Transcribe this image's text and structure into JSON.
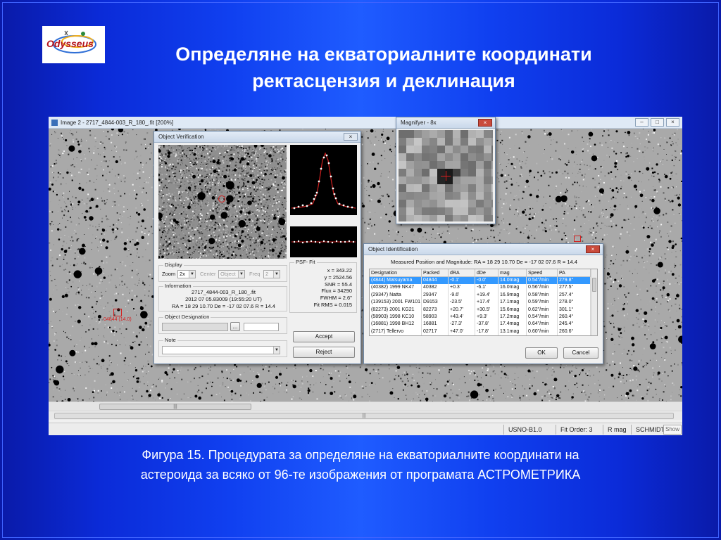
{
  "logo": {
    "text": "Odysseus"
  },
  "title": {
    "line1": "Определяне на екваториалните координати",
    "line2": "ректасцензия и деклинация"
  },
  "screenshot": {
    "image_title": "Image 2 - 2717_4844-003_R_180_.fit [200%]",
    "object_label": "04844 (14.0)",
    "verification": {
      "title": "Object Verification",
      "display": {
        "label": "Display",
        "zoom_label": "Zoom",
        "zoom_value": "2x",
        "center_label": "Center",
        "center_value": "Object",
        "freq_label": "Freq",
        "freq_value": "2"
      },
      "psf": {
        "label": "PSF- Fit",
        "x": "x = 343.22",
        "y": "y = 2524.56",
        "snr": "SNR = 55.4",
        "flux": "Flux = 34290",
        "fwhm": "FWHM = 2.6''",
        "fitrms": "Fit RMS = 0.015"
      },
      "information": {
        "label": "Information",
        "file": "2717_4844-003_R_180_.fit",
        "date": "2012 07 05.83009 (19:55:20 UT)",
        "coords": "RA = 18 29 10.70   De = -17 02 07.6   R = 14.4"
      },
      "designation": {
        "label": "Object Designation",
        "btn": "..."
      },
      "note": {
        "label": "Note"
      },
      "accept": "Accept",
      "reject": "Reject"
    },
    "magnifier": {
      "title": "Magnifyer - 8x"
    },
    "identification": {
      "title": "Object Identification",
      "measured": "Measured Position and Magnitude:  RA = 18 29 10.70   De = -17 02 07.6   R = 14.4",
      "columns": [
        "Designation",
        "Packed",
        "dRA",
        "dDe",
        "mag",
        "Speed",
        "PA"
      ],
      "rows": [
        [
          "(4844) Matsuyama",
          "04844",
          "-0.1'",
          "-0.0'",
          "14.0mag",
          "0.54\"/min",
          "279.8°"
        ],
        [
          "(40382) 1999 NK47",
          "40382",
          "+0.3'",
          "-6.1'",
          "16.0mag",
          "0.56\"/min",
          "277.5°"
        ],
        [
          "(29347) Natta",
          "29347",
          "-9.6'",
          "+19.4'",
          "16.9mag",
          "0.58\"/min",
          "257.4°"
        ],
        [
          "(139153) 2001 FW101",
          "D9153",
          "-23.5'",
          "+17.4'",
          "17.1mag",
          "0.59\"/min",
          "278.0°"
        ],
        [
          "(82273) 2001 KG21",
          "82273",
          "+20.7'",
          "+30.5'",
          "15.6mag",
          "0.62\"/min",
          "301.1°"
        ],
        [
          "(58903) 1998 KC10",
          "58903",
          "+43.4'",
          "+9.3'",
          "17.2mag",
          "0.54\"/min",
          "260.4°"
        ],
        [
          "(16881) 1998 BH12",
          "16881",
          "-27.3'",
          "-37.8'",
          "17.4mag",
          "0.64\"/min",
          "245.4°"
        ],
        [
          "(2717) Tellervo",
          "02717",
          "+47.0'",
          "-17.8'",
          "13.1mag",
          "0.60\"/min",
          "260.6°"
        ]
      ],
      "ok": "OK",
      "cancel": "Cancel"
    },
    "status": {
      "catalog": "USNO-B1.0",
      "fit_order": "Fit Order: 3",
      "mag": "R mag",
      "telescope": "SCHMIDT",
      "show": "Show"
    }
  },
  "caption": {
    "line1": "Фигура 15. Процедурата за определяне на екваториалните координати на",
    "line2": "астероида за всяко от 96-те изображения от програмата АСТРОМЕТРИКА"
  }
}
